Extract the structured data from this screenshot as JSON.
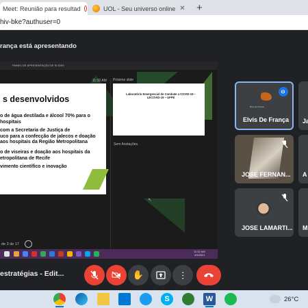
{
  "browser": {
    "tabs": [
      {
        "title": "Meet: Reunião para resultad",
        "active": true,
        "recording": true
      },
      {
        "title": "UOL - Seu universo online",
        "active": false
      }
    ],
    "url": "hiv-bke?authuser=0"
  },
  "meet": {
    "presenting_text": "rança está apresentando",
    "meeting_title": "estratégias - Edit...",
    "participants": [
      {
        "name": "Elvis De França",
        "speaking": true,
        "avatar_caption": "Elvis de França"
      },
      {
        "name": "Ja"
      },
      {
        "name": "JOSE FERNAN...",
        "muted": true
      },
      {
        "name": "A"
      },
      {
        "name": "JOSE LAMARTI...",
        "muted": true
      },
      {
        "name": "M"
      }
    ]
  },
  "shared_screen": {
    "ppt_header": "PAINEL DE APRESENTAÇÃO DE SLIDES",
    "clock": "11:32 AM",
    "next_slide_label": "Próximo slide",
    "slide_title": "s desenvolvidos",
    "slide_bullets": [
      "o de água destilada e álcool 70% para o",
      "hospitais",
      "com a Secretaria de Justiça de",
      "uco para a confecção de jalecos e doação",
      "aos hospitais da Região Metropolitana",
      "o de viseiras e doação aos hospitais da",
      "etropolitana de Recife",
      "vimento científico e inovação"
    ],
    "next_slide_text": "Laboratório Emergencial de Combate a COVID-19 – LECOVID-19 – UFPE",
    "notes_label": "Sem Anotações.",
    "slide_counter": "de 3 de 17",
    "taskbar_time": "11:32 AM",
    "taskbar_date": "4/5/2021"
  },
  "taskbar": {
    "temperature": "26°C"
  }
}
